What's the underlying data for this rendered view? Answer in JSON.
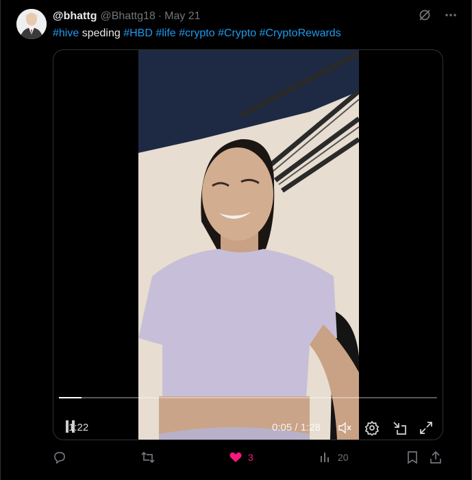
{
  "tweet": {
    "display_name": "@bhattg",
    "handle": "@Bhattg18",
    "separator": "·",
    "date": "May 21",
    "text_parts": [
      {
        "text": "#hive",
        "tag": true
      },
      {
        "text": " speding ",
        "tag": false
      },
      {
        "text": "#HBD",
        "tag": true
      },
      {
        "text": " ",
        "tag": false
      },
      {
        "text": "#life",
        "tag": true
      },
      {
        "text": " ",
        "tag": false
      },
      {
        "text": "#crypto",
        "tag": true
      },
      {
        "text": " ",
        "tag": false
      },
      {
        "text": "#Crypto",
        "tag": true
      },
      {
        "text": " ",
        "tag": false
      },
      {
        "text": "#CryptoRewards",
        "tag": true
      }
    ]
  },
  "video": {
    "remaining_time": "1:22",
    "time_display": "0:05 / 1:28",
    "progress": 0.06
  },
  "actions": {
    "reply_icon": "reply-icon",
    "retweet_icon": "retweet-icon",
    "like_count": "3",
    "views_count": "20"
  },
  "colors": {
    "accent": "#1d9bf0",
    "like": "#f91880",
    "muted": "#71767b"
  }
}
